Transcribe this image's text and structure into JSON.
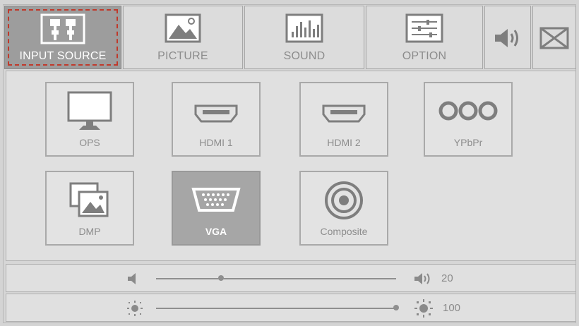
{
  "tabs": [
    {
      "label": "INPUT SOURCE",
      "icon": "input-source-icon",
      "active": true
    },
    {
      "label": "PICTURE",
      "icon": "picture-icon",
      "active": false
    },
    {
      "label": "SOUND",
      "icon": "sound-icon",
      "active": false
    },
    {
      "label": "OPTION",
      "icon": "option-icon",
      "active": false
    }
  ],
  "quick": [
    {
      "icon": "speaker-icon"
    },
    {
      "icon": "close-box-icon"
    }
  ],
  "sources": [
    {
      "label": "OPS",
      "icon": "monitor-icon",
      "selected": false
    },
    {
      "label": "HDMI 1",
      "icon": "hdmi-icon",
      "selected": false
    },
    {
      "label": "HDMI 2",
      "icon": "hdmi-icon",
      "selected": false
    },
    {
      "label": "YPbPr",
      "icon": "component-ports-icon",
      "selected": false
    },
    {
      "label": "DMP",
      "icon": "media-gallery-icon",
      "selected": false
    },
    {
      "label": "VGA",
      "icon": "vga-port-icon",
      "selected": true
    },
    {
      "label": "Composite",
      "icon": "composite-port-icon",
      "selected": false
    }
  ],
  "volume": {
    "value": "20",
    "level": 0.27
  },
  "brightness": {
    "value": "100",
    "level": 1.0
  },
  "colors": {
    "active_tab": "#9d9d9d",
    "focus_ring": "#c0392b",
    "selected_source": "#a6a6a6"
  }
}
